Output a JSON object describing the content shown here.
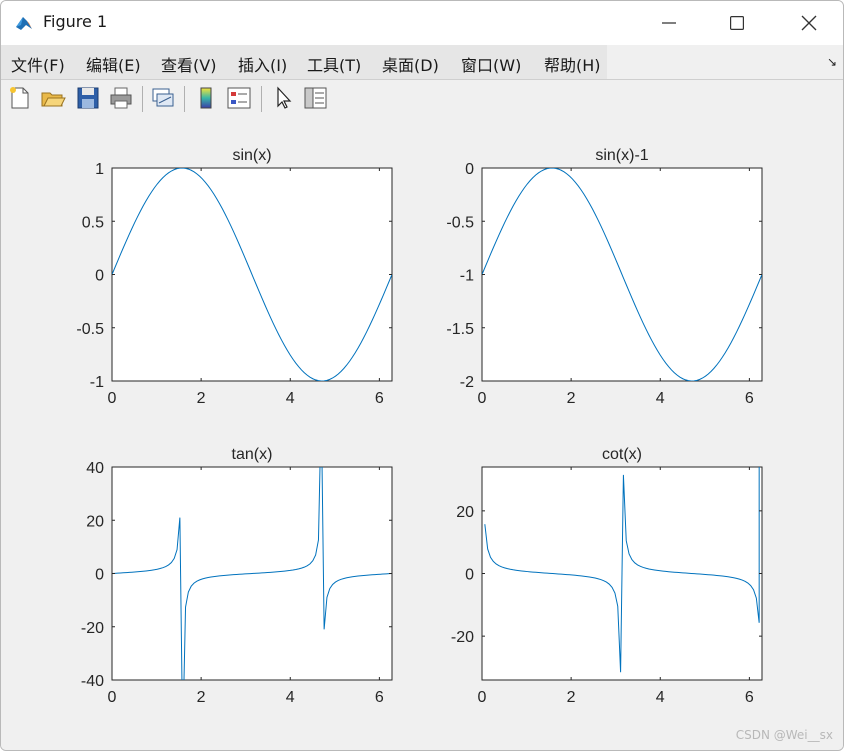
{
  "window": {
    "title": "Figure 1"
  },
  "menu": [
    {
      "label": "文件(F)"
    },
    {
      "label": "编辑(E)"
    },
    {
      "label": "查看(V)"
    },
    {
      "label": "插入(I)"
    },
    {
      "label": "工具(T)"
    },
    {
      "label": "桌面(D)"
    },
    {
      "label": "窗口(W)"
    },
    {
      "label": "帮助(H)"
    }
  ],
  "toolbar": {
    "icons": [
      "new-figure-icon",
      "open-file-icon",
      "save-icon",
      "print-icon",
      "link-plot-icon",
      "colorbar-icon",
      "legend-icon",
      "edit-plot-arrow-icon",
      "property-inspector-icon"
    ]
  },
  "colors": {
    "line": "#0072bd",
    "axes": "#262626",
    "background": "#f0f0f0"
  },
  "watermark": "CSDN @Wei__sx",
  "chart_data": [
    {
      "type": "line",
      "title": "sin(x)",
      "function": "sin",
      "xlim": [
        0,
        6.2832
      ],
      "ylim": [
        -1,
        1
      ],
      "xticks": [
        "0",
        "2",
        "4",
        "6"
      ],
      "yticks": [
        "1",
        "0.5",
        "0",
        "-0.5",
        "-1"
      ],
      "x": [
        0,
        0.5236,
        1.0472,
        1.5708,
        2.0944,
        2.618,
        3.1416,
        3.6652,
        4.1888,
        4.7124,
        5.236,
        5.7596,
        6.2832
      ],
      "y": [
        0,
        0.5,
        0.866,
        1,
        0.866,
        0.5,
        0,
        -0.5,
        -0.866,
        -1,
        -0.866,
        -0.5,
        0
      ]
    },
    {
      "type": "line",
      "title": "sin(x)-1",
      "function": "sin_minus_1",
      "xlim": [
        0,
        6.2832
      ],
      "ylim": [
        -2,
        0
      ],
      "xticks": [
        "0",
        "2",
        "4",
        "6"
      ],
      "yticks": [
        "0",
        "-0.5",
        "-1",
        "-1.5",
        "-2"
      ],
      "x": [
        0,
        0.5236,
        1.0472,
        1.5708,
        2.0944,
        2.618,
        3.1416,
        3.6652,
        4.1888,
        4.7124,
        5.236,
        5.7596,
        6.2832
      ],
      "y": [
        -1,
        -0.5,
        -0.134,
        0,
        -0.134,
        -0.5,
        -1,
        -1.5,
        -1.866,
        -2,
        -1.866,
        -1.5,
        -1
      ]
    },
    {
      "type": "line",
      "title": "tan(x)",
      "function": "tan",
      "xlim": [
        0,
        6.2832
      ],
      "ylim": [
        -40,
        40
      ],
      "xticks": [
        "0",
        "2",
        "4",
        "6"
      ],
      "yticks": [
        "40",
        "20",
        "0",
        "-20",
        "-40"
      ],
      "x": [
        0,
        0.785,
        1.2,
        1.4,
        1.5,
        1.55,
        1.6,
        1.65,
        1.8,
        2.356,
        3.1416,
        3.93,
        4.4,
        4.6,
        4.7,
        4.75,
        4.8,
        5.2,
        5.5,
        6.2832
      ],
      "y": [
        0,
        1,
        2.6,
        5.8,
        14.1,
        12,
        -37.5,
        -12.6,
        -4.3,
        -1,
        0,
        1,
        3.1,
        8.9,
        37.3,
        -12.4,
        -11.4,
        -1.9,
        -0.9,
        0
      ]
    },
    {
      "type": "line",
      "title": "cot(x)",
      "function": "cot",
      "xlim": [
        0,
        6.2832
      ],
      "ylim": [
        -34,
        34
      ],
      "xticks": [
        "0",
        "2",
        "4",
        "6"
      ],
      "yticks": [
        "20",
        "0",
        "-20"
      ],
      "x": [
        0.1,
        0.2,
        0.5,
        0.785,
        1.5708,
        2.356,
        2.8,
        3.0,
        3.08,
        3.2,
        3.3,
        3.5,
        3.927,
        4.7124,
        5.498,
        5.9,
        6.1,
        6.17,
        6.22,
        6.26
      ],
      "y": [
        9.97,
        4.93,
        1.83,
        1,
        0,
        -1,
        -2.8,
        -7.0,
        -16,
        17,
        6.0,
        2.7,
        1,
        0,
        -1,
        -2.6,
        -5.4,
        -8.8,
        -15,
        -34
      ]
    }
  ]
}
